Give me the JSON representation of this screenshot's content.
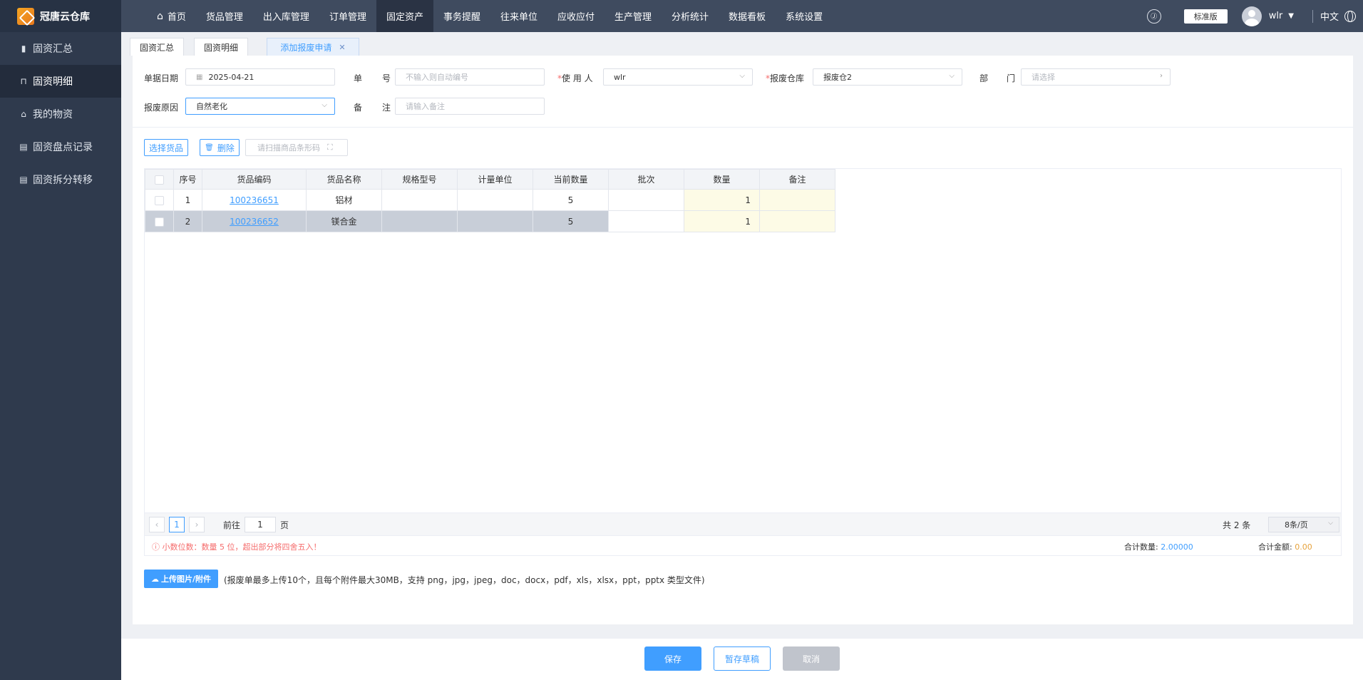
{
  "app": {
    "name": "冠唐云仓库"
  },
  "sidebar": {
    "items": [
      {
        "label": "固资汇总",
        "icon": "bar-chart-icon"
      },
      {
        "label": "固资明细",
        "icon": "cart-icon"
      },
      {
        "label": "我的物资",
        "icon": "basket-icon"
      },
      {
        "label": "固资盘点记录",
        "icon": "clipboard-icon"
      },
      {
        "label": "固资拆分转移",
        "icon": "clipboard-icon"
      }
    ]
  },
  "topnav": {
    "items": [
      "首页",
      "货品管理",
      "出入库管理",
      "订单管理",
      "固定资产",
      "事务提醒",
      "往来单位",
      "应收应付",
      "生产管理",
      "分析统计",
      "数据看板",
      "系统设置"
    ],
    "edition": "标准版",
    "user": "wlr",
    "lang": "中文"
  },
  "tabs": [
    {
      "label": "固资汇总"
    },
    {
      "label": "固资明细"
    },
    {
      "label": "添加报废申请"
    }
  ],
  "form": {
    "date_label": "单据日期",
    "date_value": "2025-04-21",
    "no_label_1": "单",
    "no_label_2": "号",
    "no_placeholder": "不输入则自动编号",
    "user_label_req": "*",
    "user_label": "使 用 人",
    "user_value": "wlr",
    "warehouse_req": "*",
    "warehouse_label": "报废仓库",
    "warehouse_value": "报废仓2",
    "dept_label_1": "部",
    "dept_label_2": "门",
    "dept_placeholder": "请选择",
    "reason_label": "报废原因",
    "reason_value": "自然老化",
    "remark_label_1": "备",
    "remark_label_2": "注",
    "remark_placeholder": "请输入备注"
  },
  "toolbar": {
    "select_goods": "选择货品",
    "delete": "删除",
    "scan_placeholder": "请扫描商品条形码"
  },
  "table": {
    "headers": [
      "序号",
      "货品编码",
      "货品名称",
      "规格型号",
      "计量单位",
      "当前数量",
      "批次",
      "数量",
      "备注"
    ],
    "rows": [
      {
        "no": "1",
        "code": "100236651",
        "name": "铝材",
        "spec": "",
        "unit": "",
        "current": "5",
        "batch": "",
        "qty": "1",
        "remark": ""
      },
      {
        "no": "2",
        "code": "100236652",
        "name": "镁合金",
        "spec": "",
        "unit": "",
        "current": "5",
        "batch": "",
        "qty": "1",
        "remark": ""
      }
    ]
  },
  "pager": {
    "page": "1",
    "goto_prefix": "前往",
    "goto_value": "1",
    "goto_suffix": "页",
    "total": "共 2 条",
    "page_size": "8条/页"
  },
  "tips": {
    "warning": "小数位数：数量 5 位，超出部分将四舍五入！",
    "total_qty_label": "合计数量:",
    "total_qty_value": "2.00000",
    "total_amt_label": "合计金额:",
    "total_amt_value": "0.00"
  },
  "upload": {
    "label": "上传图片/附件",
    "note": "(报废单最多上传10个，且每个附件最大30MB，支持 png，jpg，jpeg，doc，docx，pdf，xls，xlsx，ppt，pptx 类型文件)"
  },
  "footer": {
    "save": "保存",
    "draft": "暂存草稿",
    "cancel": "取消"
  },
  "colors": {
    "primary": "#409eff",
    "sidebar": "#2f3a4d",
    "topnav": "#3f4b5f",
    "danger": "#f56c6c",
    "warning": "#e6a23c"
  }
}
